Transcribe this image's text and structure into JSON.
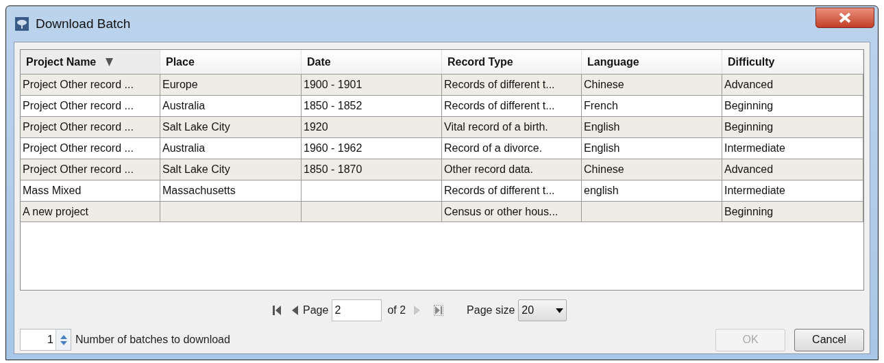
{
  "window": {
    "title": "Download Batch"
  },
  "table": {
    "columns": [
      {
        "label": "Project Name",
        "sorted": true
      },
      {
        "label": "Place",
        "sorted": false
      },
      {
        "label": "Date",
        "sorted": false
      },
      {
        "label": "Record Type",
        "sorted": false
      },
      {
        "label": "Language",
        "sorted": false
      },
      {
        "label": "Difficulty",
        "sorted": false
      }
    ],
    "rows": [
      [
        "Project Other record ...",
        "Europe",
        "1900 - 1901",
        "Records of different t...",
        "Chinese",
        "Advanced"
      ],
      [
        "Project Other record ...",
        "Australia",
        "1850 - 1852",
        "Records of different t...",
        "French",
        "Beginning"
      ],
      [
        "Project Other record ...",
        "Salt Lake City",
        "1920",
        "Vital record of a birth.",
        "English",
        "Beginning"
      ],
      [
        "Project Other record ...",
        "Australia",
        "1960 - 1962",
        "Record of a divorce.",
        "English",
        "Intermediate"
      ],
      [
        "Project Other record ...",
        "Salt Lake City",
        "1850 - 1870",
        "Other record data.",
        "Chinese",
        "Advanced"
      ],
      [
        "Mass Mixed",
        "Massachusetts",
        "",
        "Records of different t...",
        "english",
        "Intermediate"
      ],
      [
        "A new project",
        "",
        "",
        "Census or other hous...",
        "",
        "Beginning"
      ]
    ]
  },
  "pager": {
    "page_label": "Page",
    "page": "2",
    "of_label": "of 2",
    "first_disabled": false,
    "prev_disabled": false,
    "next_disabled": true,
    "last_disabled": true,
    "page_size_label": "Page size",
    "page_size": "20"
  },
  "batches": {
    "value": "1",
    "label": "Number of batches to download"
  },
  "buttons": [
    {
      "label": "OK",
      "disabled": true
    },
    {
      "label": "Cancel",
      "disabled": false
    }
  ]
}
